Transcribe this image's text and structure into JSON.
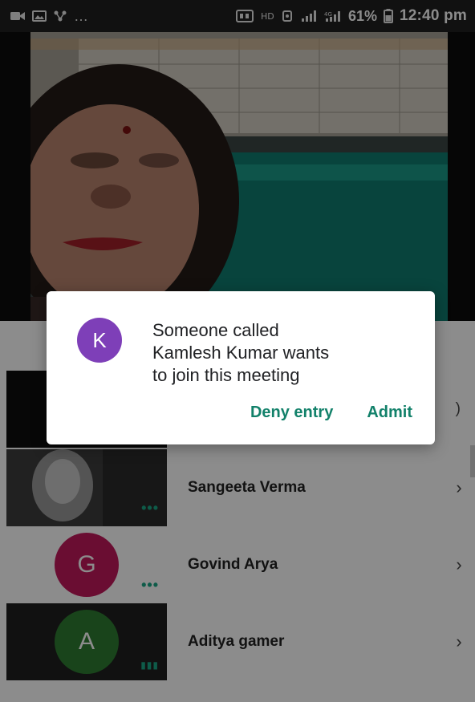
{
  "status_bar": {
    "icons_left": [
      "video-call-icon",
      "image-icon",
      "network-icon"
    ],
    "overflow": "…",
    "icons_right": [
      "dual-sim-icon",
      "hd-icon",
      "vibrate-icon",
      "signal-icon",
      "4g-signal-icon",
      "battery-icon"
    ],
    "battery": "61%",
    "time": "12:40 pm"
  },
  "participants": [
    {
      "name": "Sangeeta Verma",
      "avatar_letter": "",
      "avatar_color": "#4a4a4a",
      "indicator": "•••"
    },
    {
      "name": "Govind Arya",
      "avatar_letter": "G",
      "avatar_color": "#c2185b",
      "indicator": "•••"
    },
    {
      "name": "Aditya gamer",
      "avatar_letter": "A",
      "avatar_color": "#2e7d32",
      "indicator": "▮▮▮"
    }
  ],
  "partial_row_suffix": ")",
  "chevron": "›",
  "dialog": {
    "avatar_letter": "K",
    "avatar_color": "#7e3fb8",
    "message_line1": "Someone called",
    "message_line2": "Kamlesh Kumar wants",
    "message_line3": "to join this meeting",
    "deny_label": "Deny entry",
    "admit_label": "Admit"
  },
  "colors": {
    "accent": "#12816a",
    "indicator": "#1aa785"
  }
}
